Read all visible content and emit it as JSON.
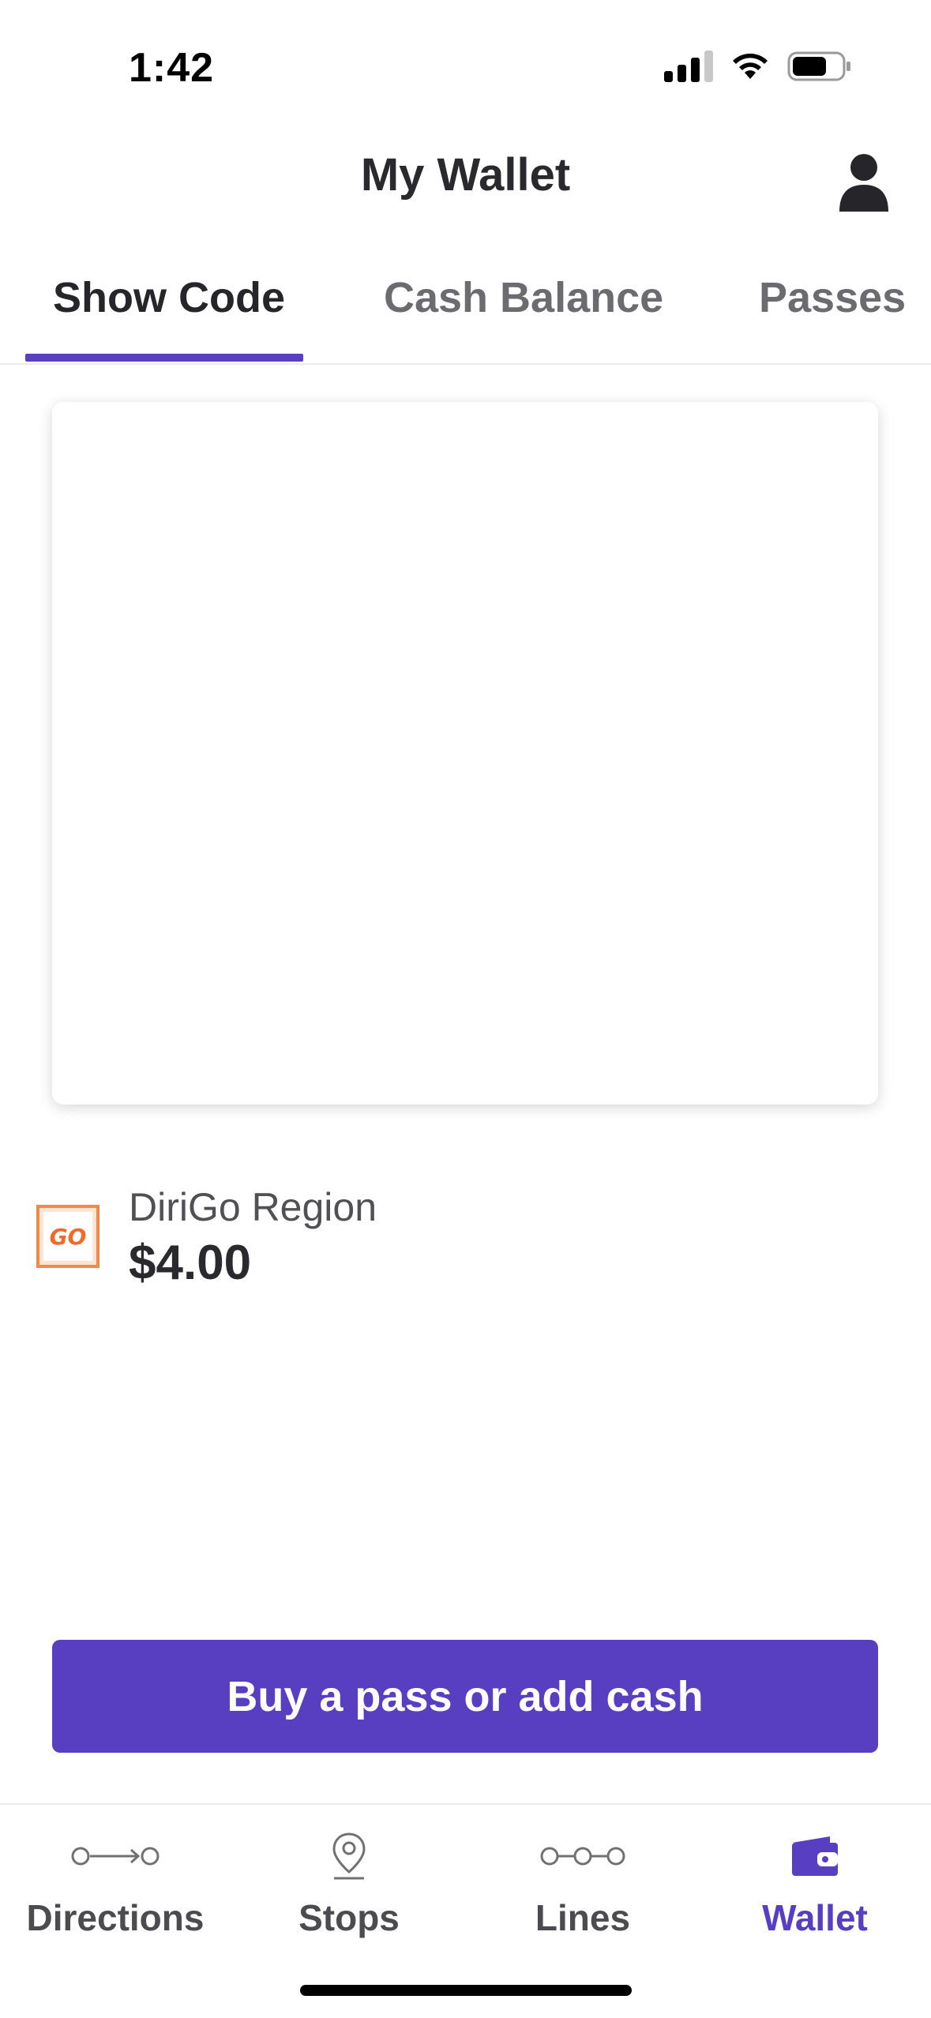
{
  "status_bar": {
    "time": "1:42"
  },
  "header": {
    "title": "My Wallet"
  },
  "tabs": [
    {
      "label": "Show Code",
      "active": true
    },
    {
      "label": "Cash Balance",
      "active": false
    },
    {
      "label": "Passes",
      "active": false
    }
  ],
  "balance": {
    "agency_name": "DiriGo Region",
    "amount": "$4.00",
    "logo_text": "GO"
  },
  "primary_action": {
    "label": "Buy a pass or add cash"
  },
  "bottom_nav": [
    {
      "label": "Directions",
      "icon": "directions-icon",
      "active": false
    },
    {
      "label": "Stops",
      "icon": "location-pin-icon",
      "active": false
    },
    {
      "label": "Lines",
      "icon": "lines-icon",
      "active": false
    },
    {
      "label": "Wallet",
      "icon": "wallet-icon",
      "active": true
    }
  ],
  "colors": {
    "accent": "#583fc1",
    "logo_orange": "#f08a4b"
  }
}
